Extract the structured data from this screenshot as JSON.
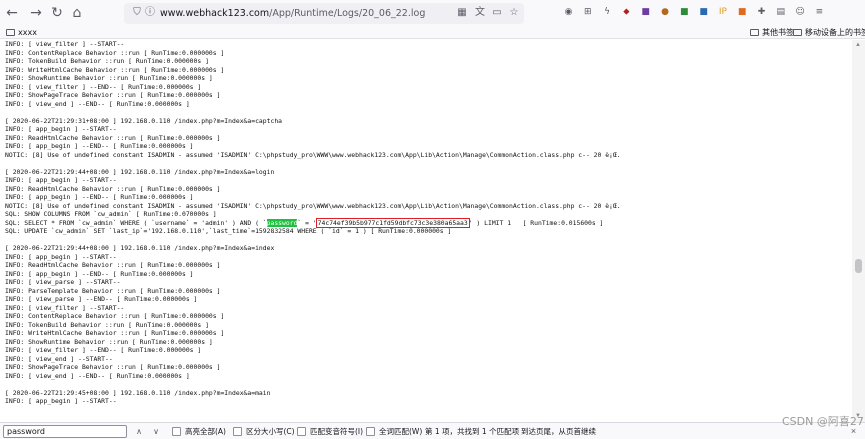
{
  "browser": {
    "url_host": "www.webhack123.com",
    "url_path": "/App/Runtime/Logs/20_06_22.log",
    "nav": {
      "back_icon": "←",
      "forward_icon": "→",
      "reload_icon": "↻",
      "home_icon": "⌂"
    },
    "extensions": [
      {
        "name": "account-icon",
        "glyph": "◉",
        "color": "#5b5b66"
      },
      {
        "name": "grid-icon",
        "glyph": "⊞",
        "color": "#5b5b66"
      },
      {
        "name": "bolt-icon",
        "glyph": "ϟ",
        "color": "#5b5b66"
      },
      {
        "name": "tag-icon",
        "glyph": "⬥",
        "color": "#b02020"
      },
      {
        "name": "extension-purple-icon",
        "glyph": "■",
        "color": "#6b3fa0"
      },
      {
        "name": "cookie-icon",
        "glyph": "●",
        "color": "#b06a20"
      },
      {
        "name": "extension-green-icon",
        "glyph": "■",
        "color": "#2f8a3a"
      },
      {
        "name": "extension-blue-icon",
        "glyph": "■",
        "color": "#2a6ab0"
      },
      {
        "name": "ip-icon",
        "glyph": "IP",
        "color": "#e0a020"
      },
      {
        "name": "extension-orange-icon",
        "glyph": "■",
        "color": "#e06a20"
      },
      {
        "name": "puzzle-icon",
        "glyph": "✚",
        "color": "#5b5b66"
      },
      {
        "name": "library-icon",
        "glyph": "▤",
        "color": "#5b5b66"
      },
      {
        "name": "user-icon",
        "glyph": "☺",
        "color": "#5b5b66"
      },
      {
        "name": "menu-icon",
        "glyph": "≡",
        "color": "#5b5b66"
      }
    ]
  },
  "bookmarks": {
    "left": "xxxx",
    "right": [
      "其他书签",
      "移动设备上的书签"
    ]
  },
  "log_lines": [
    "INFO: [ view_filter ] --START--",
    "INFO: ContentReplace Behavior ::run [ RunTime:0.000000s ]",
    "INFO: TokenBuild Behavior ::run [ RunTime:0.000000s ]",
    "INFO: WriteHtmlCache Behavior ::run [ RunTime:0.000000s ]",
    "INFO: ShowRuntime Behavior ::run [ RunTime:0.000000s ]",
    "INFO: [ view_filter ] --END-- [ RunTime:0.000000s ]",
    "INFO: ShowPageTrace Behavior ::run [ RunTime:0.000000s ]",
    "INFO: [ view_end ] --END-- [ RunTime:0.000000s ]",
    "",
    "[ 2020-06-22T21:29:31+08:00 ] 192.168.0.110 /index.php?m=Index&a=captcha",
    "INFO: [ app_begin ] --START--",
    "INFO: ReadHtmlCache Behavior ::run [ RunTime:0.000000s ]",
    "INFO: [ app_begin ] --END-- [ RunTime:0.000000s ]",
    "NOTIC: [8] Use of undefined constant ISADMIN - assumed 'ISADMIN' C:\\phpstudy_pro\\WWW\\www.webhack123.com\\App\\Lib\\Action\\Manage\\CommonAction.class.php c-- 20 è¡Œ.",
    "",
    "[ 2020-06-22T21:29:44+08:00 ] 192.168.0.110 /index.php?m=Index&a=login",
    "INFO: [ app_begin ] --START--",
    "INFO: ReadHtmlCache Behavior ::run [ RunTime:0.000000s ]",
    "INFO: [ app_begin ] --END-- [ RunTime:0.000000s ]",
    "NOTIC: [8] Use of undefined constant ISADMIN - assumed 'ISADMIN' C:\\phpstudy_pro\\WWW\\www.webhack123.com\\App\\Lib\\Action\\Manage\\CommonAction.class.php c-- 20 è¡Œ.",
    "SQL: SHOW COLUMNS FROM `cw_admin` [ RunTime:0.070000s ]",
    "__SQL_PASSWORD_LINE__",
    "SQL: UPDATE `cw_admin` SET `last_ip`='192.168.0.110',`last_time`=1592832584 WHERE ( `id` = 1 ) [ RunTime:0.000000s ]",
    "",
    "[ 2020-06-22T21:29:44+08:00 ] 192.168.0.110 /index.php?m=Index&a=index",
    "INFO: [ app_begin ] --START--",
    "INFO: ReadHtmlCache Behavior ::run [ RunTime:0.000000s ]",
    "INFO: [ app_begin ] --END-- [ RunTime:0.000000s ]",
    "INFO: [ view_parse ] --START--",
    "INFO: ParseTemplate Behavior ::run [ RunTime:0.000000s ]",
    "INFO: [ view_parse ] --END-- [ RunTime:0.000000s ]",
    "INFO: [ view_filter ] --START--",
    "INFO: ContentReplace Behavior ::run [ RunTime:0.000000s ]",
    "INFO: TokenBuild Behavior ::run [ RunTime:0.000000s ]",
    "INFO: WriteHtmlCache Behavior ::run [ RunTime:0.000000s ]",
    "INFO: ShowRuntime Behavior ::run [ RunTime:0.000000s ]",
    "INFO: [ view_filter ] --END-- [ RunTime:0.000000s ]",
    "INFO: [ view_end ] --START--",
    "INFO: ShowPageTrace Behavior ::run [ RunTime:0.000000s ]",
    "INFO: [ view_end ] --END-- [ RunTime:0.000000s ]",
    "",
    "[ 2020-06-22T21:29:45+08:00 ] 192.168.0.110 /index.php?m=Index&a=main",
    "INFO: [ app_begin ] --START--"
  ],
  "sql_password_line": {
    "prefix": "SQL: SELECT * FROM `cw_admin` WHERE ( `username` = 'admin' ) AND ( `",
    "password_word": "password",
    "middle": "` = '",
    "hash": "74c74ef39b5b977c1fd59dbfc73c3e380a65aa3",
    "after_hash": "' ) LIMIT 1",
    "runtime": "[ RunTime:0.015600s ]"
  },
  "findbar": {
    "query": "password",
    "up_arrow": "∧",
    "down_arrow": "∨",
    "options": [
      "高亮全部(A)",
      "区分大小写(C)",
      "匹配变音符号(I)",
      "全词匹配(W)"
    ],
    "status": "第 1 项，共找到 1 个匹配项",
    "wrap_status": "到达页尾，从页首继续",
    "close": "×"
  },
  "watermark": "CSDN @阿喜27"
}
